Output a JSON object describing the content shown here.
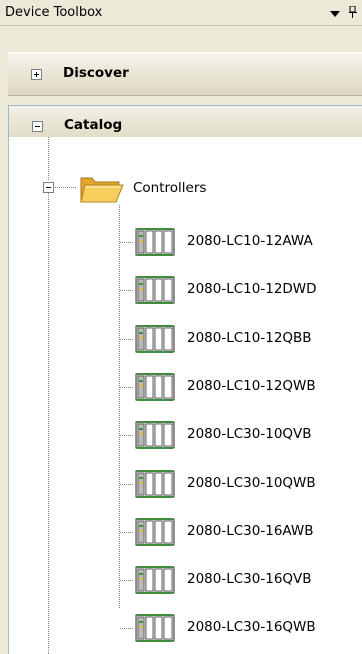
{
  "toolbox": {
    "title": "Device Toolbox",
    "dropdown_icon": "chevron-down-icon",
    "pin_icon": "pin-icon"
  },
  "sections": {
    "discover": {
      "label": "Discover",
      "expanded": false
    },
    "catalog": {
      "label": "Catalog",
      "expanded": true
    }
  },
  "tree": {
    "root_label": "Controllers",
    "root_icon": "open-folder-icon",
    "item_icon": "controller-module-icon",
    "items": [
      "2080-LC10-12AWA",
      "2080-LC10-12DWD",
      "2080-LC10-12QBB",
      "2080-LC10-12QWB",
      "2080-LC30-10QVB",
      "2080-LC30-10QWB",
      "2080-LC30-16AWB",
      "2080-LC30-16QVB",
      "2080-LC30-16QWB"
    ]
  },
  "colors": {
    "panel_bg": "#ece9d8",
    "tree_bg": "#ffffff",
    "catalog_border": "#9fb8d6",
    "folder_yellow": "#f5c542",
    "module_green": "#3f8f3a"
  }
}
